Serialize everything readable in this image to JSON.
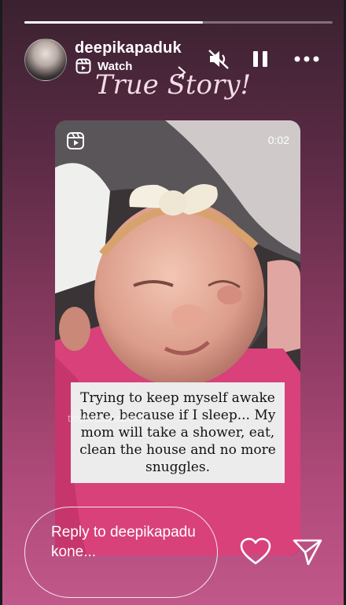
{
  "story": {
    "progress": 0.58,
    "username": "deepikapaduk",
    "watch_label": "Watch",
    "overlay_title": "True Story!"
  },
  "controls": {
    "mute_icon": "speaker-muted-icon",
    "pause_icon": "pause-icon",
    "more_icon": "more-icon"
  },
  "video": {
    "time": "0:02",
    "caption": "Trying to keep myself awake here, because if I sleep... My mom will take a shower, eat, clean the house and no more snuggles.",
    "watermark": "tiny.tots.academy"
  },
  "reply": {
    "placeholder": "Reply to deepikapadukone..."
  },
  "colors": {
    "background_top": "#3a2230",
    "background_bottom": "#c0588a",
    "title_tint": "#f3dce6"
  }
}
